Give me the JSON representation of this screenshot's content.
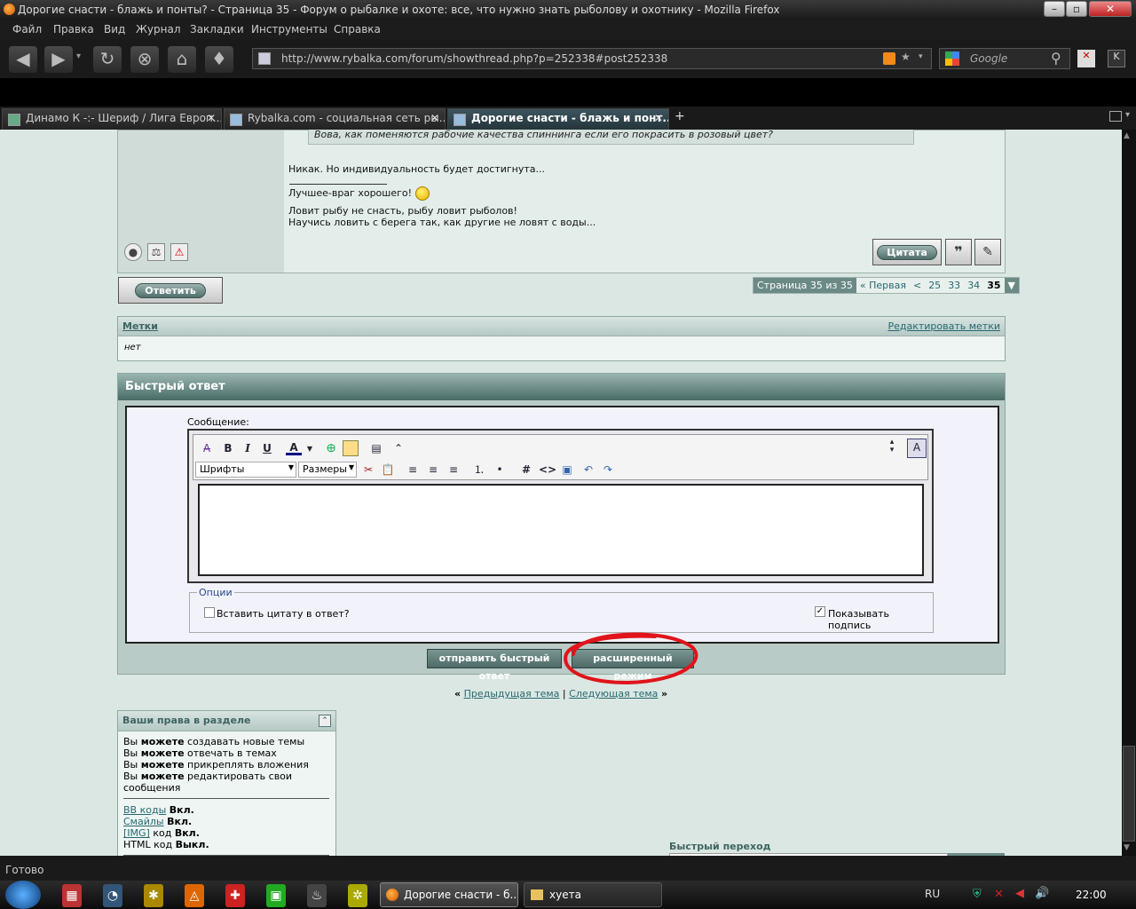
{
  "browser": {
    "title": "Дорогие снасти - блажь и понты? - Страница 35 - Форум о рыбалке и охоте: все, что нужно знать рыболову и охотнику - Mozilla Firefox",
    "menu": [
      "Файл",
      "Правка",
      "Вид",
      "Журнал",
      "Закладки",
      "Инструменты",
      "Справка"
    ],
    "url": "http://www.rybalka.com/forum/showthread.php?p=252338#post252338",
    "search_placeholder": "Google",
    "tabs": [
      {
        "label": "Динамо К -:- Шериф / Лига Европ...",
        "active": false
      },
      {
        "label": "Rybalka.com - социальная сеть ры...",
        "active": false
      },
      {
        "label": "Дорогие снасти - блажь и понт...",
        "active": true
      }
    ],
    "status": "Готово"
  },
  "post": {
    "quote": "Вова, как поменяются рабочие качества спиннинга если его покрасить в розовый цвет?",
    "reply": "Никак. Но индивидуальность будет достигнута...",
    "sig1": "Лучшее-враг хорошего!",
    "sig2": "Ловит рыбу не снасть, рыбу ловит рыболов!",
    "sig3": "Научись ловить с берега так, как другие не ловят с воды...",
    "quote_button": "Цитата"
  },
  "reply_button": "Ответить",
  "pagenav": {
    "current": "Страница 35 из 35",
    "first": "« Первая",
    "prev": "<",
    "pages": [
      "25",
      "33",
      "34"
    ],
    "active_page": "35"
  },
  "tags": {
    "title": "Метки",
    "edit": "Редактировать метки",
    "value": "нет"
  },
  "quick_reply": {
    "title": "Быстрый ответ",
    "message_label": "Сообщение:",
    "font_select": "Шрифты",
    "size_select": "Размеры",
    "options_legend": "Опции",
    "quote_checkbox": "Вставить цитату в ответ?",
    "signature_checkbox": "Показывать подпись",
    "submit_button": "отправить быстрый ответ",
    "advanced_button": "расширенный режим"
  },
  "thread_nav": {
    "prev": "Предыдущая тема",
    "sep": "|",
    "next": "Следующая тема"
  },
  "rights": {
    "title": "Ваши права в разделе",
    "lines": [
      {
        "pre": "Вы ",
        "bold": "можете",
        "post": " создавать новые темы"
      },
      {
        "pre": "Вы ",
        "bold": "можете",
        "post": " отвечать в темах"
      },
      {
        "pre": "Вы ",
        "bold": "можете",
        "post": " прикреплять вложения"
      },
      {
        "pre": "Вы ",
        "bold": "можете",
        "post": " редактировать свои сообщения"
      }
    ],
    "codes": [
      {
        "link": "BB коды",
        "mid": "",
        "state": "Вкл."
      },
      {
        "link": "Смайлы",
        "mid": "",
        "state": "Вкл."
      },
      {
        "link": "[IMG]",
        "mid": "код",
        "state": "Вкл."
      },
      {
        "link": "",
        "mid": "HTML код",
        "state": "Выкл."
      }
    ]
  },
  "quick_nav": "Быстрый переход",
  "taskbar": {
    "items": [
      {
        "label": "Дорогие снасти - б...",
        "active": true
      },
      {
        "label": "хуета",
        "active": false
      }
    ],
    "lang": "RU",
    "time": "22:00"
  },
  "colors": {
    "highlight_circle": "#e0141a",
    "header_teal": "#486b66"
  }
}
